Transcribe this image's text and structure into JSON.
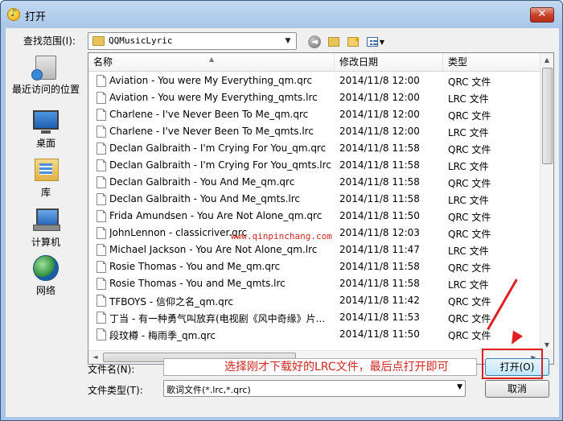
{
  "window": {
    "title": "打开",
    "close_label": "✕"
  },
  "lookin": {
    "label": "查找范围(I):",
    "value": "QQMusicLyric",
    "dropdown_glyph": "▼"
  },
  "toolbar": {
    "back_glyph": "◄",
    "up_glyph": "▲",
    "new_glyph": "✦",
    "view_glyph": "▼"
  },
  "places": [
    {
      "label": "最近访问的位置",
      "icon": "recent-places-icon"
    },
    {
      "label": "桌面",
      "icon": "desktop-icon"
    },
    {
      "label": "库",
      "icon": "libraries-icon"
    },
    {
      "label": "计算机",
      "icon": "computer-icon"
    },
    {
      "label": "网络",
      "icon": "network-icon"
    }
  ],
  "columns": {
    "name": "名称",
    "date": "修改日期",
    "type": "类型",
    "sort_glyph": "▲"
  },
  "files": [
    {
      "name": "Aviation - You were My Everything_qm.qrc",
      "date": "2014/11/8 12:00",
      "type": "QRC 文件"
    },
    {
      "name": "Aviation - You were My Everything_qmts.lrc",
      "date": "2014/11/8 12:00",
      "type": "LRC 文件"
    },
    {
      "name": "Charlene - I've Never Been To Me_qm.qrc",
      "date": "2014/11/8 12:00",
      "type": "QRC 文件"
    },
    {
      "name": "Charlene - I've Never Been To Me_qmts.lrc",
      "date": "2014/11/8 12:00",
      "type": "LRC 文件"
    },
    {
      "name": "Declan Galbraith - I'm Crying For You_qm.qrc",
      "date": "2014/11/8 11:58",
      "type": "QRC 文件"
    },
    {
      "name": "Declan Galbraith - I'm Crying For You_qmts.lrc",
      "date": "2014/11/8 11:58",
      "type": "LRC 文件"
    },
    {
      "name": "Declan Galbraith - You And Me_qm.qrc",
      "date": "2014/11/8 11:58",
      "type": "QRC 文件"
    },
    {
      "name": "Declan Galbraith - You And Me_qmts.lrc",
      "date": "2014/11/8 11:58",
      "type": "LRC 文件"
    },
    {
      "name": "Frida Amundsen - You Are Not Alone_qm.qrc",
      "date": "2014/11/8 11:50",
      "type": "QRC 文件"
    },
    {
      "name": "JohnLennon - classicriver.qrc",
      "date": "2014/11/8 12:03",
      "type": "QRC 文件"
    },
    {
      "name": "Michael Jackson - You Are Not Alone_qm.lrc",
      "date": "2014/11/8 11:47",
      "type": "LRC 文件"
    },
    {
      "name": "Rosie Thomas - You and Me_qm.qrc",
      "date": "2014/11/8 11:58",
      "type": "QRC 文件"
    },
    {
      "name": "Rosie Thomas - You and Me_qmts.lrc",
      "date": "2014/11/8 11:58",
      "type": "LRC 文件"
    },
    {
      "name": "TFBOYS - 信仰之名_qm.qrc",
      "date": "2014/11/8 11:42",
      "type": "QRC 文件"
    },
    {
      "name": "丁当 - 有一种勇气叫放弃(电视剧《风中奇缘》片...",
      "date": "2014/11/8 11:53",
      "type": "QRC 文件"
    },
    {
      "name": "段玟樽 - 梅雨季_qm.qrc",
      "date": "2014/11/8 11:50",
      "type": "QRC 文件"
    }
  ],
  "scroll_glyphs": {
    "up": "▲",
    "down": "▼",
    "left": "◄",
    "right": "►"
  },
  "watermark": "www.qinpinchang.com",
  "filename": {
    "label": "文件名(N):",
    "value": ""
  },
  "filetype": {
    "label": "文件类型(T):",
    "value": "歌词文件(*.lrc,*.qrc)",
    "dropdown_glyph": "▼"
  },
  "instruction": "选择刚才下载好的LRC文件，最后点打开即可",
  "buttons": {
    "open": "打开(O)",
    "cancel": "取消"
  },
  "colors": {
    "annotation": "#d2271e",
    "titlebar": "#a9c6e6"
  }
}
